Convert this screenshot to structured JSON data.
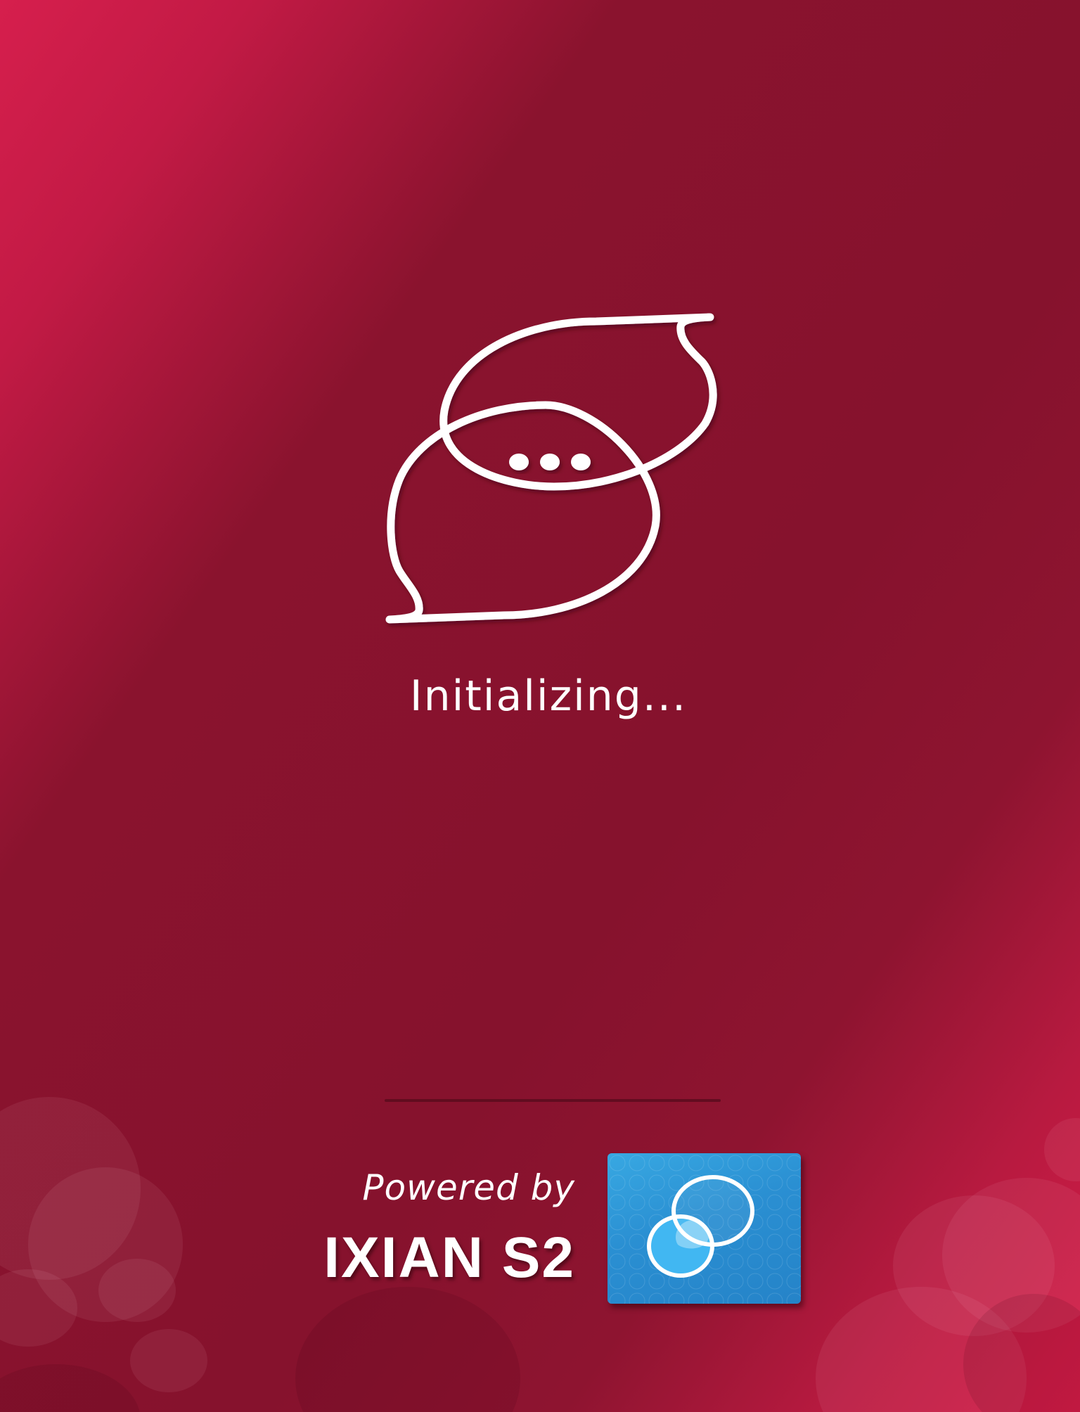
{
  "app": {
    "status_text": "Initializing...",
    "logo_icon": "chat-bubbles-icon"
  },
  "footer": {
    "powered_by_label": "Powered by",
    "brand_name": "IXIAN S2",
    "brand_logo_icon": "ixian-overlapping-circles-icon"
  },
  "colors": {
    "background_primary": "#86122d",
    "background_accent": "#d61f4d",
    "text": "#ffffff",
    "brand_logo_background": "#2a8fd2"
  }
}
